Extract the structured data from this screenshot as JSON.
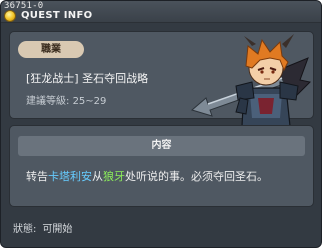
{
  "window": {
    "quest_id": "36751-0",
    "title": "QUEST INFO"
  },
  "quest": {
    "job_badge": "職業",
    "name": "[狂龙战士] 圣石夺回战略",
    "level_label": "建議等級:",
    "level_range": "25~29"
  },
  "content": {
    "header": "内容",
    "text_parts": {
      "prefix": "转告",
      "npc": "卡塔利安",
      "mid": "从",
      "place": "狼牙",
      "suffix": "处听说的事。必须夺回圣石。"
    }
  },
  "status": {
    "label": "狀態:",
    "value": "可開始"
  },
  "colors": {
    "npc_highlight": "#66ccff",
    "place_highlight": "#8cf05a",
    "badge_bg": "#d9c9b2"
  }
}
